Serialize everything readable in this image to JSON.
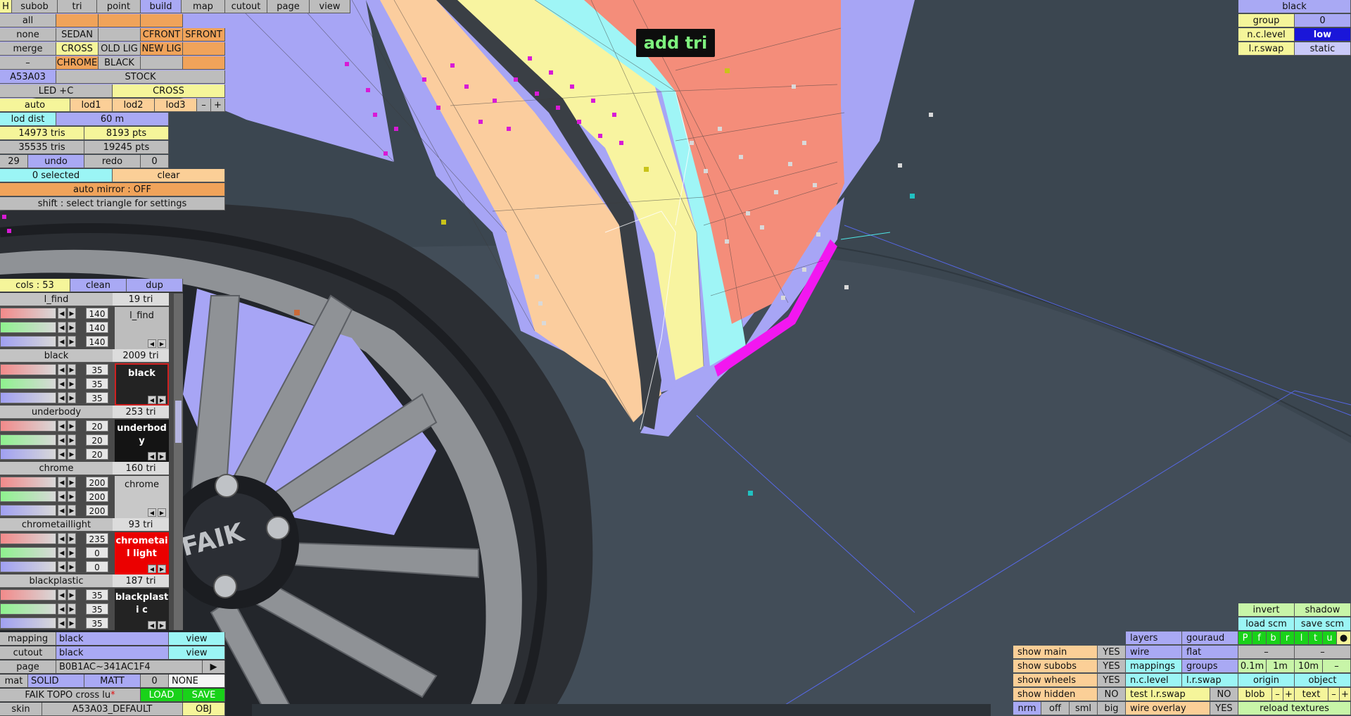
{
  "overlay": {
    "add_tri": "add tri"
  },
  "menu": {
    "h": "H",
    "tabs": [
      "subob",
      "tri",
      "point",
      "build",
      "map",
      "cutout",
      "page",
      "view"
    ]
  },
  "left_top": {
    "all": "all",
    "none": "none",
    "sedan": "SEDAN",
    "cfront": "CFRONT",
    "sfront": "SFRONT",
    "merge": "merge",
    "cross": "CROSS",
    "old_lig": "OLD LIG",
    "new_lig": "NEW LIG",
    "dash": "–",
    "chrome": "CHROME",
    "black": "BLACK",
    "code": "A53A03",
    "stock": "STOCK",
    "led": "LED +C",
    "cross2": "CROSS",
    "auto": "auto",
    "lod1": "lod1",
    "lod2": "lod2",
    "lod3": "lod3",
    "minus": "–",
    "plus": "+",
    "lod_dist_label": "lod dist",
    "lod_dist_value": "60 m",
    "tris1": "14973 tris",
    "pts1": "8193 pts",
    "tris2": "35535 tris",
    "pts2": "19245 pts",
    "undo_count": "29",
    "undo": "undo",
    "redo": "redo",
    "redo_count": "0",
    "selected": "0 selected",
    "clear": "clear",
    "auto_mirror": "auto mirror : OFF",
    "shift_hint": "shift : select triangle for settings"
  },
  "cols_bar": {
    "cols": "cols : 53",
    "clean": "clean",
    "dup": "dup"
  },
  "materials": [
    {
      "name": "l_find",
      "tri": "19 tri",
      "r": "140",
      "g": "140",
      "b": "140",
      "swatch": "l_find",
      "swatch_bg": "#bdbdbd",
      "swatch_fg": "#111111"
    },
    {
      "name": "black",
      "tri": "2009 tri",
      "r": "35",
      "g": "35",
      "b": "35",
      "swatch": "black",
      "swatch_bg": "#232323",
      "swatch_fg": "#ffffff"
    },
    {
      "name": "underbody",
      "tri": "253 tri",
      "r": "20",
      "g": "20",
      "b": "20",
      "swatch": "underbody",
      "swatch_bg": "#141414",
      "swatch_fg": "#ffffff"
    },
    {
      "name": "chrome",
      "tri": "160 tri",
      "r": "200",
      "g": "200",
      "b": "200",
      "swatch": "chrome",
      "swatch_bg": "#c8c8c8",
      "swatch_fg": "#111111"
    },
    {
      "name": "chrometaillight",
      "tri": "93 tri",
      "r": "235",
      "g": "0",
      "b": "0",
      "swatch": "chrometail light",
      "swatch_bg": "#eb0000",
      "swatch_fg": "#ffffff"
    },
    {
      "name": "blackplastic",
      "tri": "187 tri",
      "r": "35",
      "g": "35",
      "b": "35",
      "swatch": "blackplasti c",
      "swatch_bg": "#232323",
      "swatch_fg": "#ffffff"
    }
  ],
  "left_bottom": {
    "mapping": "mapping",
    "mapping_val": "black",
    "view": "view",
    "cutout": "cutout",
    "cutout_val": "black",
    "page": "page",
    "page_val": "B0B1AC~341AC1F4",
    "page_arrow": "▶",
    "mat": "mat",
    "solid": "SOLID",
    "matt": "MATT",
    "zero": "0",
    "none": "NONE",
    "faik": "FAIK TOPO cross lu",
    "faik_star": "*",
    "load": "LOAD",
    "save": "SAVE",
    "skin": "skin",
    "skin_val": "A53A03_DEFAULT",
    "obj": "OBJ"
  },
  "top_right": {
    "title": "black",
    "group": "group",
    "group_val": "0",
    "nc_level": "n.c.level",
    "nc_val": "low",
    "lr_swap": "l.r.swap",
    "lr_val": "static"
  },
  "bottom_right": {
    "invert": "invert",
    "shadow": "shadow",
    "load_scm": "load scm",
    "save_scm": "save scm",
    "layers": "layers",
    "gouraud": "gouraud",
    "layer_btns": [
      "P",
      "f",
      "b",
      "r",
      "l",
      "t",
      "u",
      "●"
    ],
    "show_main": "show main",
    "show_main_v": "YES",
    "wire": "wire",
    "flat": "flat",
    "show_subobs": "show subobs",
    "show_subobs_v": "YES",
    "mappings": "mappings",
    "groups": "groups",
    "d01": "0.1m",
    "d1": "1m",
    "d10": "10m",
    "dminus": "–",
    "show_wheels": "show wheels",
    "show_wheels_v": "YES",
    "nc_level": "n.c.level",
    "lr_swap": "l.r.swap",
    "origin": "origin",
    "object": "object",
    "show_hidden": "show hidden",
    "show_hidden_v": "NO",
    "test_lr": "test l.r.swap",
    "test_lr_v": "NO",
    "blob": "blob",
    "text": "text",
    "minus": "–",
    "plus": "+",
    "nrm": "nrm",
    "off": "off",
    "sml": "sml",
    "big": "big",
    "wire_overlay": "wire overlay",
    "wire_overlay_v": "YES",
    "reload": "reload textures",
    "dashes": [
      "–",
      "–"
    ]
  },
  "colors": {
    "viewport_bg": "#3b4650",
    "body_salmon": "#f48d7a",
    "body_peach": "#fbcd9e",
    "body_yellow": "#f8f4a0",
    "body_cyan": "#9ff5f6",
    "body_lavender": "#a7a5f5",
    "highlight_magenta": "#f217f0",
    "tire": "#2b2e33",
    "rim": "#8f9296"
  },
  "icons": {
    "star": "star-icon"
  },
  "wheel_logo": "FAIK"
}
